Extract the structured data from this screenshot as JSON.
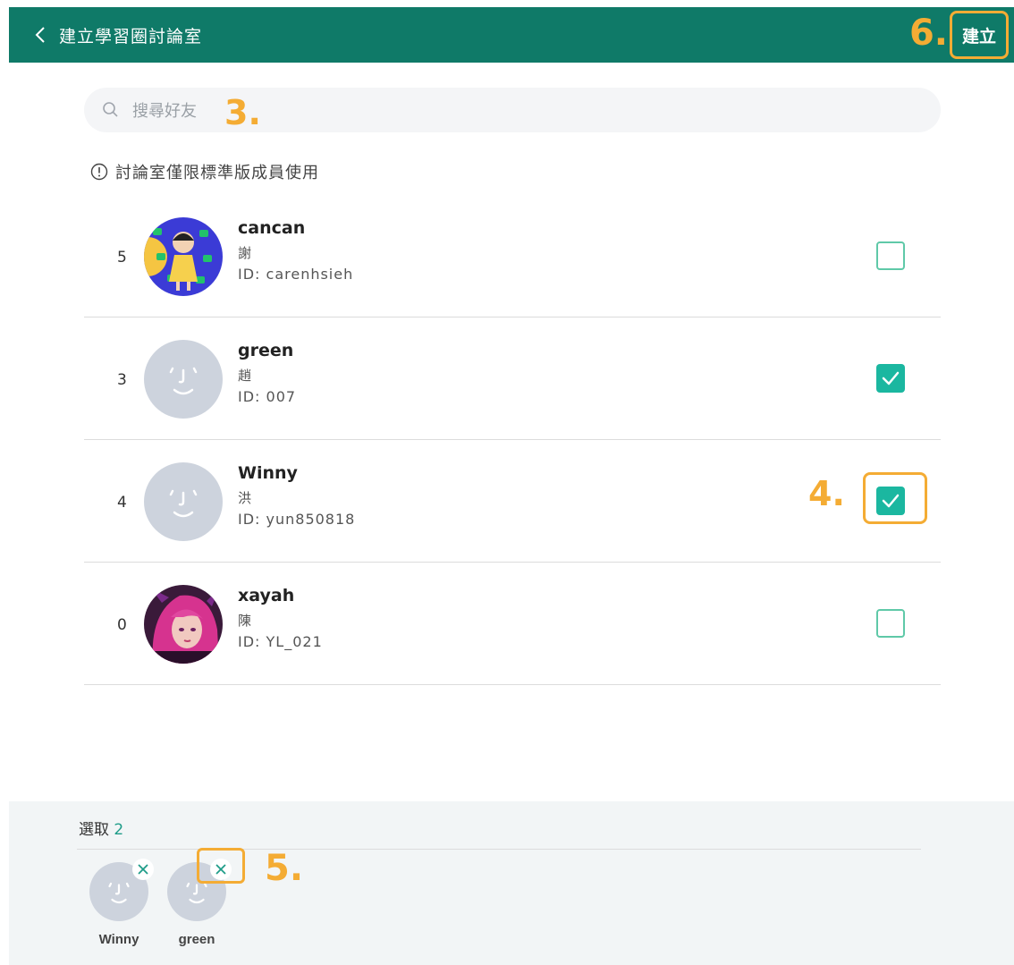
{
  "header": {
    "title": "建立學習圈討論室",
    "create_label": "建立",
    "bg_color": "#0f7a68"
  },
  "search": {
    "placeholder": "搜尋好友"
  },
  "notice": {
    "text": "討論室僅限標準版成員使用"
  },
  "annotations": {
    "step3": "3.",
    "step4": "4.",
    "step5": "5.",
    "step6": "6.",
    "color": "#f4ac34"
  },
  "friends": [
    {
      "index": "5",
      "name": "cancan",
      "subname": "謝",
      "id": "ID: carenhsieh",
      "checked": false,
      "avatar": "cartoon-girl-avatar"
    },
    {
      "index": "3",
      "name": "green",
      "subname": "趙",
      "id": "ID: 007",
      "checked": true,
      "avatar": "default-face-avatar"
    },
    {
      "index": "4",
      "name": "Winny",
      "subname": "洪",
      "id": "ID: yun850818",
      "checked": true,
      "avatar": "default-face-avatar"
    },
    {
      "index": "0",
      "name": "xayah",
      "subname": "陳",
      "id": "ID: YL_021",
      "checked": false,
      "avatar": "pink-hair-character-avatar"
    }
  ],
  "selection": {
    "label": "選取",
    "count": "2",
    "chips": [
      {
        "name": "Winny"
      },
      {
        "name": "green"
      }
    ]
  }
}
